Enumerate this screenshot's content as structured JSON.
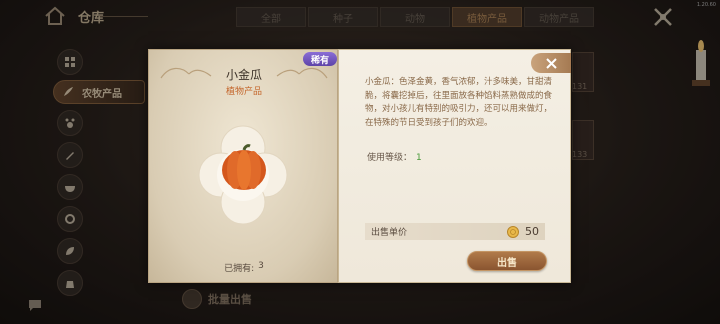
{
  "app": {
    "title": "仓库",
    "version": "1.20.60"
  },
  "tabs": [
    {
      "label": "全部"
    },
    {
      "label": "种子"
    },
    {
      "label": "动物"
    },
    {
      "label": "植物产品",
      "active": true
    },
    {
      "label": "动物产品"
    }
  ],
  "sidebar": {
    "active_label": "农牧产品",
    "icons": [
      "grid-icon",
      "feather-icon",
      "paw-icon",
      "pen-icon",
      "bowl-icon",
      "gear-icon",
      "leaf-icon",
      "pouch-icon"
    ]
  },
  "bulk_sell": {
    "label": "批量出售"
  },
  "side_items": [
    {
      "count": "131"
    },
    {
      "count": "133"
    }
  ],
  "item": {
    "name": "小金瓜",
    "category": "植物产品",
    "rarity": "稀有",
    "owned_label": "已拥有:",
    "owned_count": "3",
    "description": "小金瓜：色泽金黄，香气浓郁，汁多味美，甘甜清脆，将囊挖掉后，往里面放各种馅料蒸熟做成的食物，对小孩儿有特别的吸引力，还可以用来做灯，在特殊的节日受到孩子们的欢迎。",
    "level_label": "使用等级：",
    "level_value": "1",
    "price_label": "出售单价",
    "price_value": "50",
    "sell_label": "出售"
  },
  "colors": {
    "accent": "#c4652a",
    "rarity": "#6e52c0",
    "level": "#4a9a3a"
  }
}
